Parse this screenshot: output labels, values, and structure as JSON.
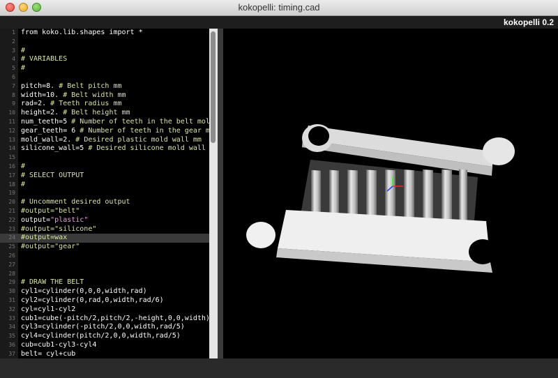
{
  "window": {
    "title": "kokopelli:  timing.cad",
    "app_name": "kokopelli 0.2"
  },
  "editor": {
    "lines": [
      {
        "n": "1",
        "text": "from koko.lib.shapes import *",
        "kind": "code"
      },
      {
        "n": "2",
        "text": "",
        "kind": "code"
      },
      {
        "n": "3",
        "text": "#",
        "kind": "comment"
      },
      {
        "n": "4",
        "text": "# VARIABLES",
        "kind": "comment"
      },
      {
        "n": "5",
        "text": "#",
        "kind": "comment"
      },
      {
        "n": "6",
        "text": "",
        "kind": "code"
      },
      {
        "n": "7",
        "text": "pitch=8. ",
        "comment": "# Belt pitch mm",
        "kind": "mixed"
      },
      {
        "n": "8",
        "text": "width=10. ",
        "comment": "# Belt width mm",
        "kind": "mixed"
      },
      {
        "n": "9",
        "text": "rad=2. ",
        "comment": "# Teeth radius mm",
        "kind": "mixed"
      },
      {
        "n": "10",
        "text": "height=2. ",
        "comment": "# Belt height mm",
        "kind": "mixed"
      },
      {
        "n": "11",
        "text": "num_teeth=5 ",
        "comment": "# Number of teeth in the belt mold (",
        "kind": "mixed"
      },
      {
        "n": "12",
        "text": "gear_teeth= 6 ",
        "comment": "# Number of teeth in the gear mold",
        "kind": "mixed"
      },
      {
        "n": "13",
        "text": "mold_wall=2. ",
        "comment": "# Desired plastic mold wall mm",
        "kind": "mixed"
      },
      {
        "n": "14",
        "text": "silicone_wall=5 ",
        "comment": "# Desired silicone mold wall mm (",
        "kind": "mixed"
      },
      {
        "n": "15",
        "text": "",
        "kind": "code"
      },
      {
        "n": "16",
        "text": "#",
        "kind": "comment"
      },
      {
        "n": "17",
        "text": "# SELECT OUTPUT",
        "kind": "comment"
      },
      {
        "n": "18",
        "text": "#",
        "kind": "comment"
      },
      {
        "n": "19",
        "text": "",
        "kind": "code"
      },
      {
        "n": "20",
        "text": "# Uncomment desired output",
        "kind": "comment"
      },
      {
        "n": "21",
        "text": "#output=\"belt\"",
        "kind": "comment"
      },
      {
        "n": "22",
        "text": "output=",
        "string": "\"plastic\"",
        "kind": "str"
      },
      {
        "n": "23",
        "text": "#output=\"silicone\"",
        "kind": "comment"
      },
      {
        "n": "24",
        "text": "#output=wax",
        "kind": "comment",
        "highlight": true
      },
      {
        "n": "25",
        "text": "#output=\"gear\"",
        "kind": "comment"
      },
      {
        "n": "26",
        "text": "",
        "kind": "code"
      },
      {
        "n": "27",
        "text": "",
        "kind": "code"
      },
      {
        "n": "28",
        "text": "",
        "kind": "code"
      },
      {
        "n": "29",
        "text": "# DRAW THE BELT",
        "kind": "comment"
      },
      {
        "n": "30",
        "text": "cyl1=cylinder(0,0,0,width,rad)",
        "kind": "code"
      },
      {
        "n": "31",
        "text": "cyl2=cylinder(0,rad,0,width,rad/6)",
        "kind": "code"
      },
      {
        "n": "32",
        "text": "cyl=cyl1-cyl2",
        "kind": "code"
      },
      {
        "n": "33",
        "text": "cub1=cube(-pitch/2,pitch/2,-height,0,0,width)",
        "kind": "code"
      },
      {
        "n": "34",
        "text": "cyl3=cylinder(-pitch/2,0,0,width,rad/5)",
        "kind": "code"
      },
      {
        "n": "35",
        "text": "cyl4=cylinder(pitch/2,0,0,width,rad/5)",
        "kind": "code"
      },
      {
        "n": "36",
        "text": "cub=cub1-cyl3-cyl4",
        "kind": "code"
      },
      {
        "n": "37",
        "text": "belt= cyl+cub",
        "kind": "code"
      }
    ]
  },
  "colors": {
    "comment": "#d6e89b",
    "string": "#e2a3e0",
    "code": "#ffffff",
    "model": "#f2f2f2",
    "axis_x": "#ff2020",
    "axis_y": "#20ff20",
    "axis_z": "#2040ff"
  }
}
